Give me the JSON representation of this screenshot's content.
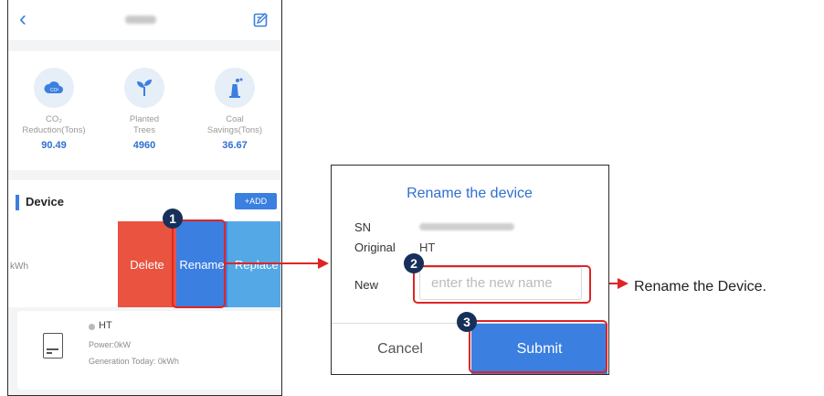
{
  "phone": {
    "back_glyph": "‹",
    "stats": [
      {
        "label_l1": "CO₂",
        "label_l2": "Reduction(Tons)",
        "value": "90.49",
        "icon": "co2-cloud-icon"
      },
      {
        "label_l1": "Planted",
        "label_l2": "Trees",
        "value": "4960",
        "icon": "sprout-icon"
      },
      {
        "label_l1": "Coal",
        "label_l2": "Savings(Tons)",
        "value": "36.67",
        "icon": "power-plant-icon"
      }
    ],
    "device_title": "Device",
    "add_label": "+ADD",
    "row_kwh": "kWh",
    "swipe": {
      "delete": "Delete",
      "rename": "Rename",
      "replace": "Replace"
    },
    "card": {
      "name": "HT",
      "power": "Power:0kW",
      "generation": "Generation Today: 0kWh"
    }
  },
  "badges": [
    "1",
    "2",
    "3"
  ],
  "dialog": {
    "title": "Rename the device",
    "sn_label": "SN",
    "original_label": "Original",
    "original_value": "HT",
    "new_label": "New",
    "new_placeholder": "enter the new name",
    "cancel": "Cancel",
    "submit": "Submit"
  },
  "side_label": "Rename the Device.",
  "colors": {
    "accent": "#3b7fe0",
    "highlight": "#e02424",
    "delete": "#e9533f",
    "badge": "#17305a"
  }
}
